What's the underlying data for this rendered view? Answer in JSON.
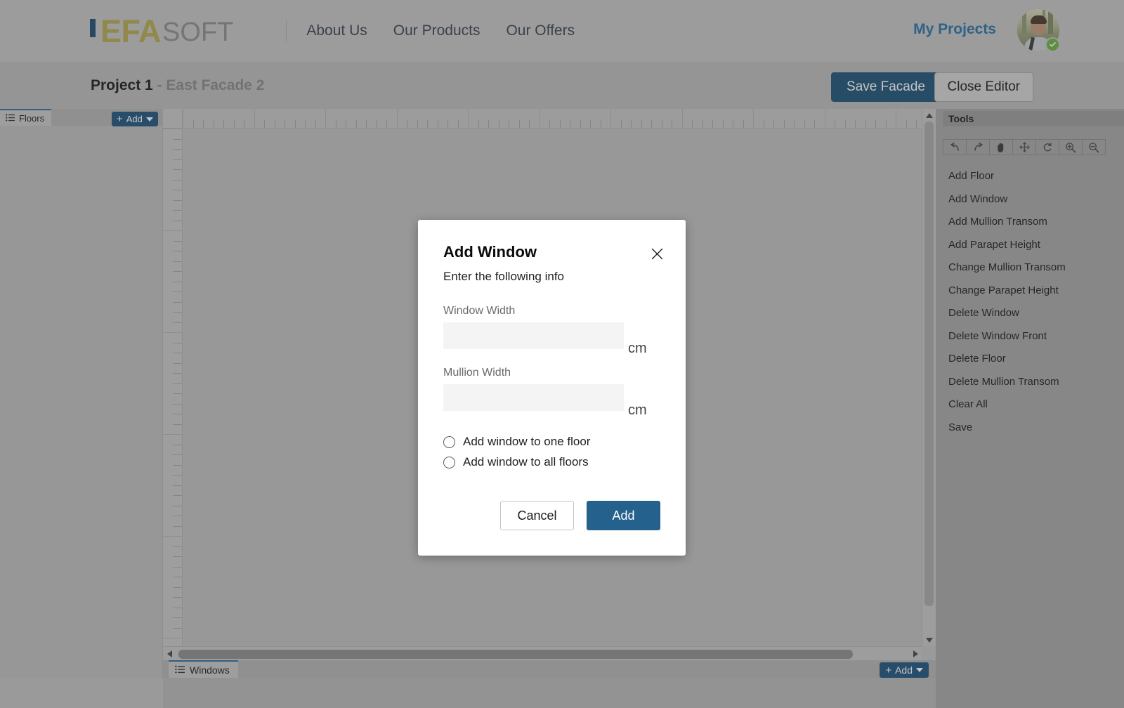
{
  "topnav": {
    "brand": {
      "primary": "EFA",
      "secondary": "SOFT"
    },
    "links": [
      {
        "label": "About Us"
      },
      {
        "label": "Our Products"
      },
      {
        "label": "Our Offers"
      }
    ],
    "my_projects": "My Projects",
    "avatar_status": "online-check"
  },
  "projectbar": {
    "project_name": "Project 1",
    "separator": " - ",
    "facade_name": "East Facade 2",
    "save_facade": "Save Facade",
    "close_editor": "Close Editor"
  },
  "floors_panel": {
    "tab_label": "Floors",
    "add_label": "Add"
  },
  "windows_panel": {
    "tab_label": "Windows",
    "add_label": "Add"
  },
  "tools": {
    "header": "Tools",
    "toolbar": [
      {
        "name": "undo-icon",
        "title": "Undo"
      },
      {
        "name": "redo-icon",
        "title": "Redo"
      },
      {
        "name": "hand-icon",
        "title": "Pan"
      },
      {
        "name": "move-icon",
        "title": "Move"
      },
      {
        "name": "rotate-icon",
        "title": "Rotate"
      },
      {
        "name": "zoom-in-icon",
        "title": "Zoom In"
      },
      {
        "name": "zoom-out-icon",
        "title": "Zoom Out"
      }
    ],
    "items": [
      {
        "label": "Add Floor"
      },
      {
        "label": "Add Window"
      },
      {
        "label": "Add Mullion Transom"
      },
      {
        "label": "Add Parapet Height"
      },
      {
        "label": "Change Mullion Transom"
      },
      {
        "label": "Change Parapet Height"
      },
      {
        "label": "Delete Window"
      },
      {
        "label": "Delete Window Front"
      },
      {
        "label": "Delete Floor"
      },
      {
        "label": "Delete Mullion Transom"
      },
      {
        "label": "Clear All"
      },
      {
        "label": "Save"
      }
    ]
  },
  "modal": {
    "title": "Add Window",
    "subtitle": "Enter the following info",
    "fields": [
      {
        "label": "Window Width",
        "value": "",
        "placeholder": "",
        "unit": "cm"
      },
      {
        "label": "Mullion Width",
        "value": "",
        "placeholder": "",
        "unit": "cm"
      }
    ],
    "radios": [
      {
        "label": "Add window to one floor",
        "selected": false
      },
      {
        "label": "Add window to all floors",
        "selected": false
      }
    ],
    "cancel_label": "Cancel",
    "submit_label": "Add"
  },
  "colors": {
    "brand_gold": "#b5ab4f",
    "brand_blue": "#1d4f72",
    "accent_link": "#2973a8",
    "primary_button": "#24618c",
    "status_online": "#6cb33f"
  }
}
